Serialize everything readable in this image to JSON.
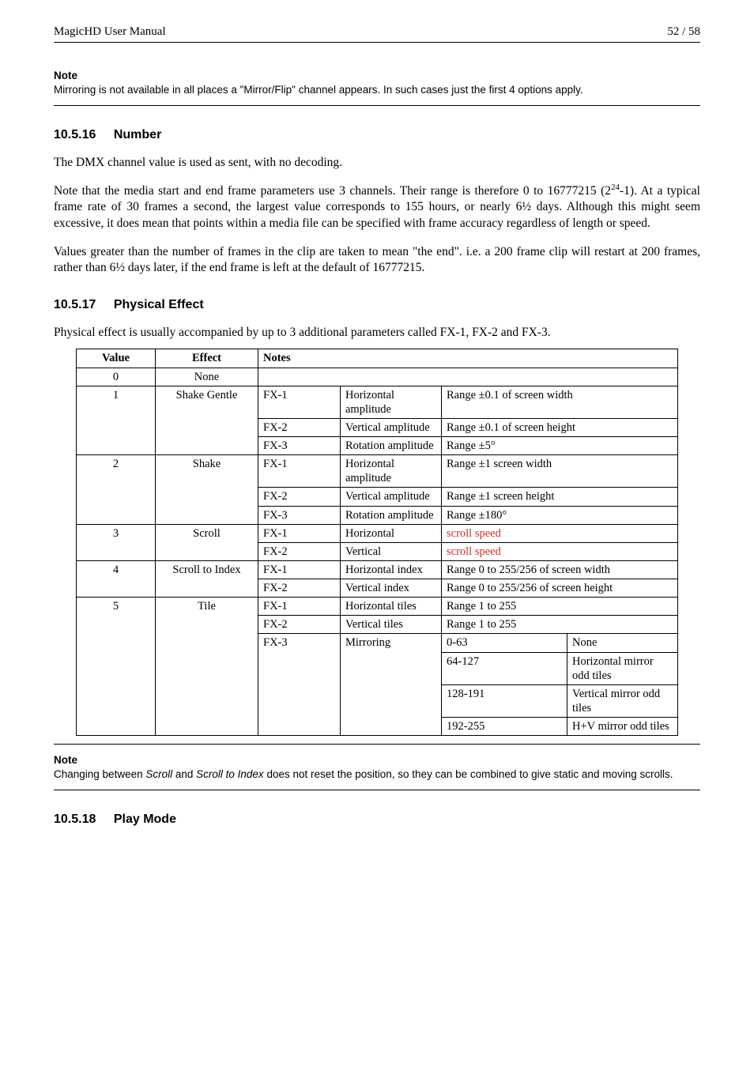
{
  "header": {
    "left": "MagicHD User Manual",
    "right": "52 / 58"
  },
  "note_top": {
    "label": "Note",
    "text": "Mirroring is not available in all places a \"Mirror/Flip\" channel appears. In such cases just the first 4 options apply."
  },
  "sec_number": {
    "num": "10.5.16",
    "title": "Number",
    "p1": "The DMX channel value is used as sent, with no decoding.",
    "p2_a": "Note that the media start and end frame parameters use 3 channels. Their range is therefore 0 to 16777215 (2",
    "p2_sup": "24",
    "p2_b": "-1). At a typical frame rate of 30 frames a second, the largest value corresponds to 155 hours, or nearly 6½ days. Although this might seem excessive, it does mean that points within a media file can be specified with frame accuracy regardless of length or speed.",
    "p3": "Values greater than the number of frames in the clip are taken to mean \"the end\". i.e. a 200 frame clip will restart at 200 frames, rather than 6½ days later, if the end frame is left at the default of 16777215."
  },
  "sec_effect": {
    "num": "10.5.17",
    "title": "Physical Effect",
    "intro": "Physical effect is usually accompanied by up to 3 additional parameters called FX-1, FX-2 and FX-3.",
    "cols": {
      "c1": "Value",
      "c2": "Effect",
      "c3": "Notes"
    },
    "rows": {
      "r0": {
        "value": "0",
        "effect": "None"
      },
      "r1": {
        "value": "1",
        "effect": "Shake Gentle",
        "fx1": "FX-1",
        "fx1d": "Horizontal amplitude",
        "fx1r": "Range ±0.1 of screen width",
        "fx2": "FX-2",
        "fx2d": "Vertical amplitude",
        "fx2r": "Range ±0.1 of screen height",
        "fx3": "FX-3",
        "fx3d": "Rotation amplitude",
        "fx3r": "Range ±5°"
      },
      "r2": {
        "value": "2",
        "effect": "Shake",
        "fx1": "FX-1",
        "fx1d": "Horizontal amplitude",
        "fx1r": "Range ±1 screen width",
        "fx2": "FX-2",
        "fx2d": "Vertical amplitude",
        "fx2r": "Range ±1 screen height",
        "fx3": "FX-3",
        "fx3d": "Rotation amplitude",
        "fx3r": "Range ±180°"
      },
      "r3": {
        "value": "3",
        "effect": "Scroll",
        "fx1": "FX-1",
        "fx1d": "Horizontal",
        "fx1r": "scroll speed",
        "fx2": "FX-2",
        "fx2d": "Vertical",
        "fx2r": "scroll speed"
      },
      "r4": {
        "value": "4",
        "effect": "Scroll to Index",
        "fx1": "FX-1",
        "fx1d": "Horizontal index",
        "fx1r": "Range 0 to 255/256 of screen width",
        "fx2": "FX-2",
        "fx2d": "Vertical index",
        "fx2r": "Range 0 to 255/256 of screen height"
      },
      "r5": {
        "value": "5",
        "effect": "Tile",
        "fx1": "FX-1",
        "fx1d": "Horizontal tiles",
        "fx1r": "Range 1 to 255",
        "fx2": "FX-2",
        "fx2d": "Vertical tiles",
        "fx2r": "Range 1 to 255",
        "fx3": "FX-3",
        "fx3d": "Mirroring",
        "m": [
          {
            "a": "0-63",
            "b": "None"
          },
          {
            "a": "64-127",
            "b": "Horizontal mirror odd tiles"
          },
          {
            "a": "128-191",
            "b": "Vertical mirror odd tiles"
          },
          {
            "a": "192-255",
            "b": "H+V mirror odd tiles"
          }
        ]
      }
    }
  },
  "note_bottom": {
    "label": "Note",
    "text_a": "Changing between ",
    "i1": "Scroll",
    "text_b": " and ",
    "i2": "Scroll to Index",
    "text_c": " does not reset the position, so they can be combined to give static and moving scrolls."
  },
  "sec_play": {
    "num": "10.5.18",
    "title": "Play Mode"
  }
}
